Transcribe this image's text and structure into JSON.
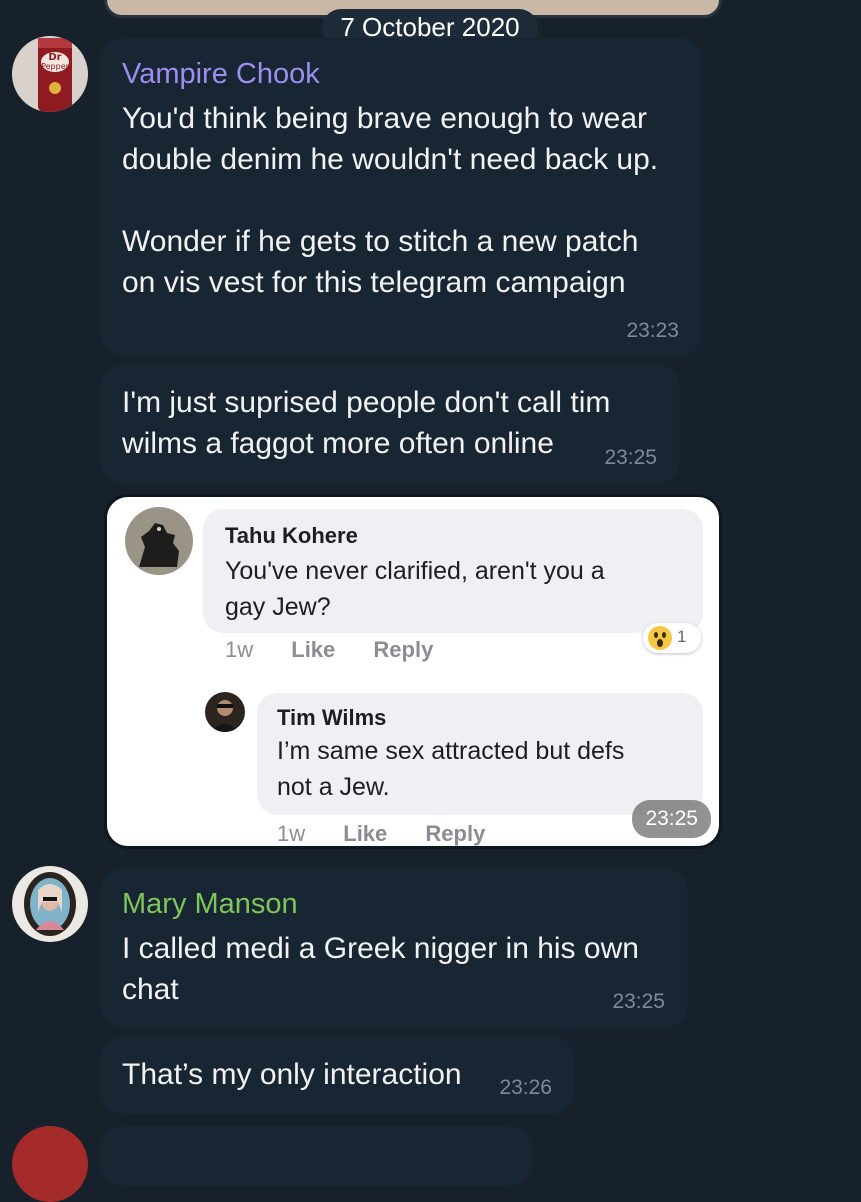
{
  "date_badge": "7 October 2020",
  "colors": {
    "background": "#17212b",
    "bubble": "#182533",
    "vampire_name": "#9e8ef0",
    "mary_name": "#7ec55a",
    "time": "#7d8b99"
  },
  "messages": [
    {
      "sender": "Vampire Chook",
      "avatar_icon": "dr-pepper-can-avatar",
      "text": "You'd think being brave enough to wear\ndouble denim he wouldn't need back up.\n\nWonder if he gets to stitch a new patch\non vis vest for this telegram campaign",
      "time": "23:23"
    },
    {
      "text": "I'm just suprised people don't call tim\nwilms a faggot more often online",
      "time": "23:25"
    },
    {
      "type": "image",
      "time": "23:25",
      "embedded": {
        "comments": [
          {
            "name": "Tahu Kohere",
            "text": "You've never clarified, aren't you a\ngay Jew?",
            "ago": "1w",
            "like": "Like",
            "reply": "Reply",
            "reaction_icon": "wow-reaction-icon",
            "reaction_count": "1"
          },
          {
            "name": "Tim Wilms",
            "text": "I’m same sex attracted but defs\nnot a Jew.",
            "ago": "1w",
            "like": "Like",
            "reply": "Reply"
          }
        ]
      }
    },
    {
      "sender": "Mary Manson",
      "avatar_icon": "framed-portrait-avatar",
      "text": "I called medi a Greek nigger in his own\nchat",
      "time": "23:25"
    },
    {
      "text": "That’s my only interaction",
      "time": "23:26"
    }
  ]
}
